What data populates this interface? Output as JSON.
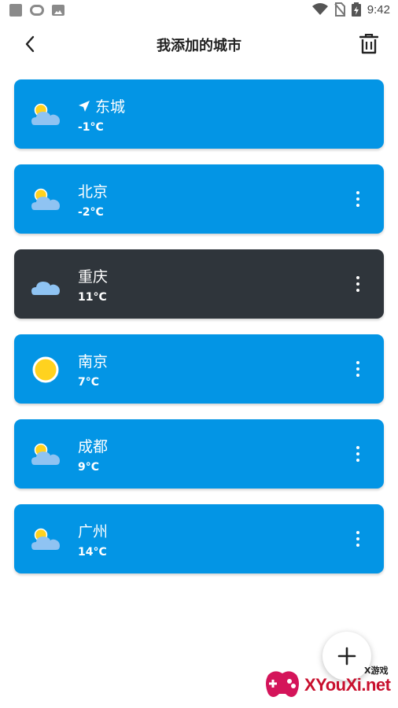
{
  "status_bar": {
    "time": "9:42"
  },
  "header": {
    "title": "我添加的城市"
  },
  "cities": [
    {
      "name": "东城",
      "temp": "-1°C",
      "icon": "partly-cloudy-icon",
      "located": true
    },
    {
      "name": "北京",
      "temp": "-2°C",
      "icon": "partly-cloudy-icon"
    },
    {
      "name": "重庆",
      "temp": "11°C",
      "icon": "cloudy-icon",
      "selected": true
    },
    {
      "name": "南京",
      "temp": "7°C",
      "icon": "sunny-icon"
    },
    {
      "name": "成都",
      "temp": "9°C",
      "icon": "partly-cloudy-icon"
    },
    {
      "name": "广州",
      "temp": "14°C",
      "icon": "partly-cloudy-icon"
    }
  ],
  "watermark": {
    "brand": "XYouXi.net",
    "small": "X游戏"
  },
  "colors": {
    "card": "#0395e5",
    "card_selected": "#2f353b",
    "cloud": "#8fc3f2",
    "sun": "#ffd21f"
  }
}
